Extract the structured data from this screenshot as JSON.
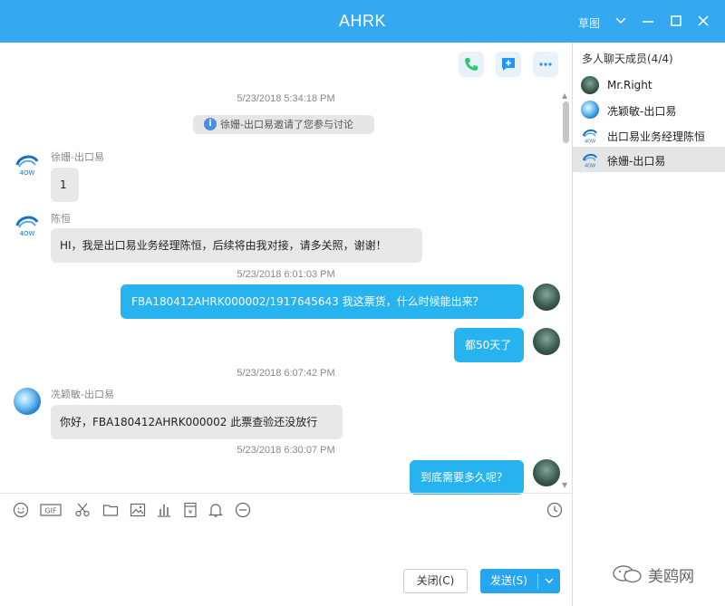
{
  "window": {
    "title": "AHRK",
    "top_label": "草图"
  },
  "chat": {
    "messages": [
      {
        "timestamp": "5/23/2018 5:34:18 PM"
      },
      {
        "system_note": "徐姗-出口易邀请了您参与讨论"
      },
      {
        "sender": "徐姗-出口易",
        "text": "1"
      },
      {
        "sender": "陈恒",
        "text": "HI，我是出口易业务经理陈恒，后续将由我对接，请多关照，谢谢！"
      },
      {
        "timestamp": "5/23/2018 6:01:03 PM"
      },
      {
        "text": "FBA180412AHRK000002/1917645643    我这票货，什么时候能出来？"
      },
      {
        "text": "都50天了"
      },
      {
        "timestamp": "5/23/2018 6:07:42 PM"
      },
      {
        "sender": "冼颖敏-出口易",
        "text": "你好，FBA180412AHRK000002 此票查验还没放行"
      },
      {
        "timestamp": "5/23/2018 6:30:07 PM"
      },
      {
        "text": "到底需要多久呢？"
      }
    ]
  },
  "composer": {
    "close_label": "关闭(C)",
    "send_label": "发送(S)"
  },
  "members": {
    "header": "多人聊天成员(4/4)",
    "list": [
      {
        "name": "Mr.Right"
      },
      {
        "name": "冼颖敏-出口易"
      },
      {
        "name": "出口易业务经理陈恒"
      },
      {
        "name": "徐姗-出口易"
      }
    ]
  },
  "watermark": "美鸥网",
  "colors": {
    "titlebar": "#34a9f2",
    "outgoing_bubble": "#26b3f0",
    "incoming_bubble": "#e8e8e8",
    "send_button": "#26a6ee"
  },
  "icons": {
    "call": "phone-icon",
    "add_chat": "add-chat-icon",
    "more": "more-icon",
    "toolbar": [
      "emoji-icon",
      "gif-icon",
      "scissors-icon",
      "folder-icon",
      "image-icon",
      "chart-icon",
      "calculator-icon",
      "bell-icon",
      "minus-circle-icon",
      "history-icon"
    ]
  }
}
